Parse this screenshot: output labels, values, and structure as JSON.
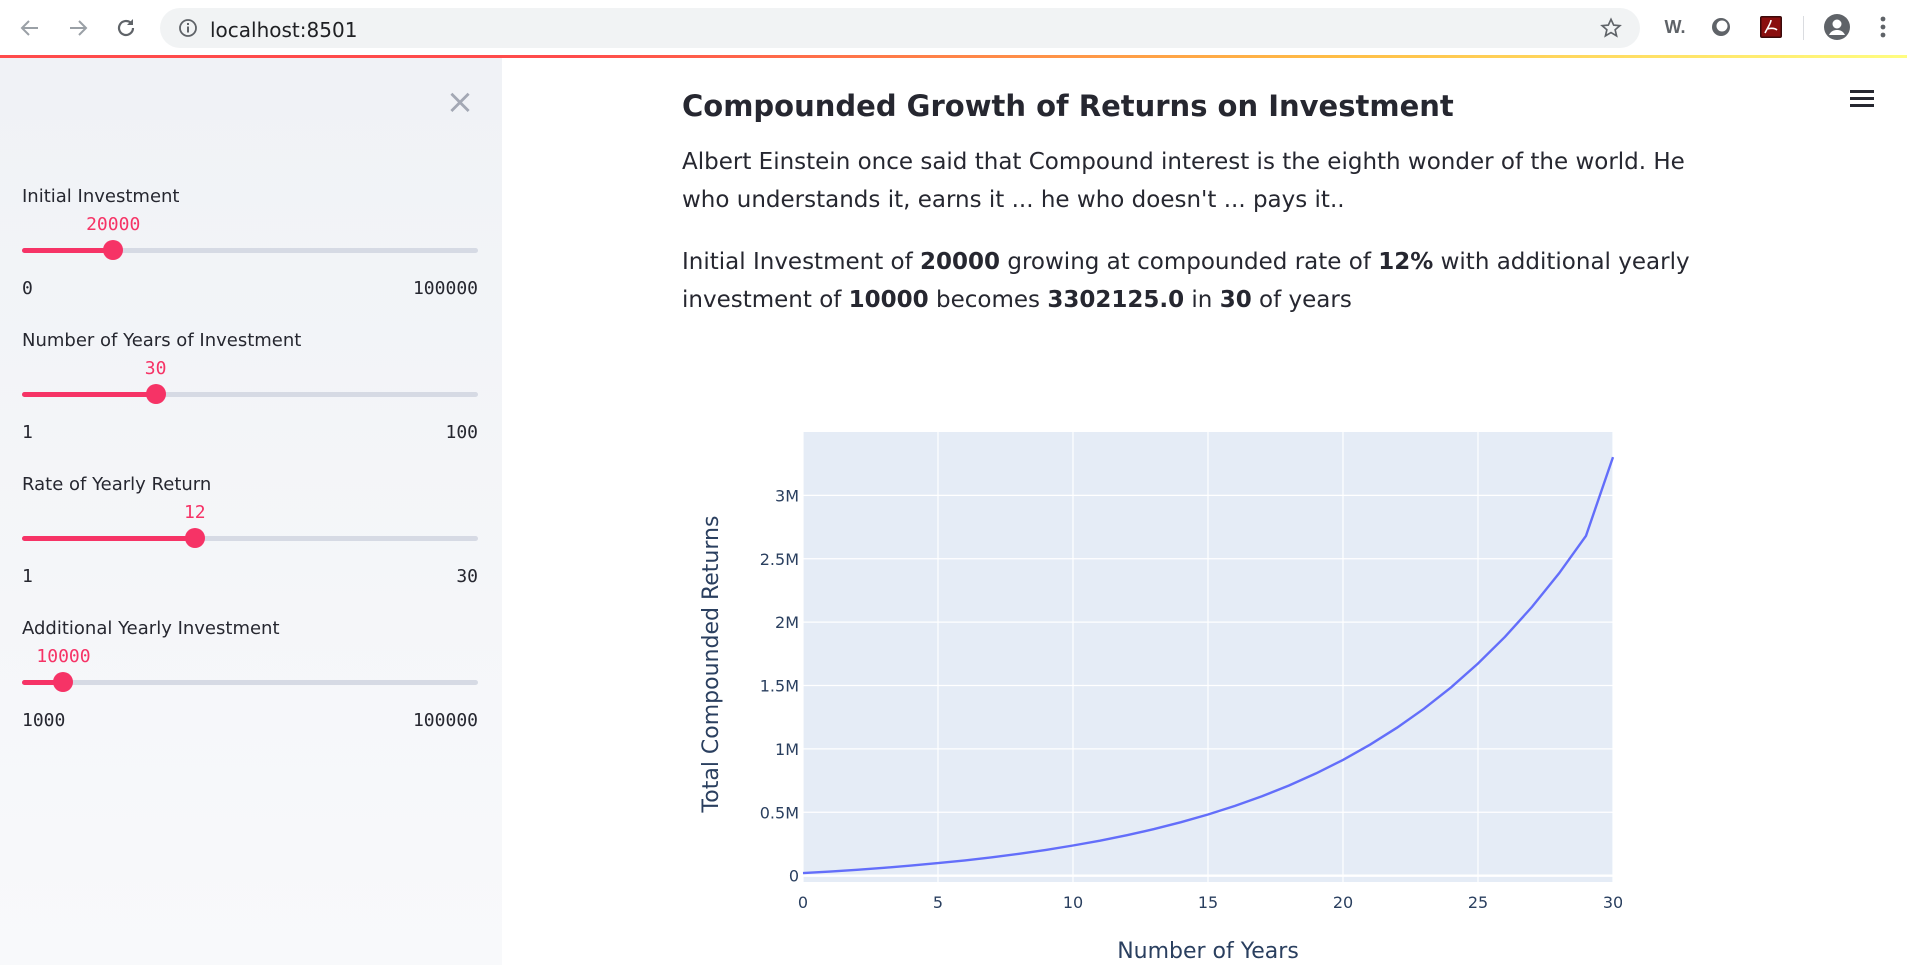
{
  "browser": {
    "url": "localhost:8501",
    "ext_w_label": "W."
  },
  "sidebar": {
    "close_label": "×",
    "sliders": [
      {
        "label": "Initial Investment",
        "value": "20000",
        "min": "0",
        "max": "100000",
        "fraction": 0.2
      },
      {
        "label": "Number of Years of Investment",
        "value": "30",
        "min": "1",
        "max": "100",
        "fraction": 0.293
      },
      {
        "label": "Rate of Yearly Return",
        "value": "12",
        "min": "1",
        "max": "30",
        "fraction": 0.379
      },
      {
        "label": "Additional Yearly Investment",
        "value": "10000",
        "min": "1000",
        "max": "100000",
        "fraction": 0.091
      }
    ]
  },
  "main": {
    "title": "Compounded Growth of Returns on Investment",
    "quote_text": "Albert Einstein once said that Compound interest is the eighth wonder of the world. He who understands it, earns it ... he who doesn't ... pays it..",
    "summary": {
      "part1": "Initial Investment of ",
      "initial": "20000",
      "part2": " growing at compounded rate of ",
      "rate": "12%",
      "part3": " with additional yearly investment of ",
      "additional": "10000",
      "part4": " becomes ",
      "result": "3302125.0",
      "part5": " in ",
      "years": "30",
      "part6": " of years"
    }
  },
  "colors": {
    "accent": "#f63366",
    "line": "#636efa",
    "plot_bg": "#e5ecf6"
  },
  "chart_data": {
    "type": "line",
    "title": "",
    "xlabel": "Number of Years",
    "ylabel": "Total Compounded Returns",
    "xlim": [
      0,
      30
    ],
    "ylim": [
      -50000,
      3500000
    ],
    "xticks": [
      0,
      5,
      10,
      15,
      20,
      25,
      30
    ],
    "xtick_labels": [
      "0",
      "5",
      "10",
      "15",
      "20",
      "25",
      "30"
    ],
    "yticks": [
      0,
      500000,
      1000000,
      1500000,
      2000000,
      2500000,
      3000000
    ],
    "ytick_labels": [
      "0",
      "0.5M",
      "1M",
      "1.5M",
      "2M",
      "2.5M",
      "3M"
    ],
    "grid": true,
    "series": [
      {
        "x": [
          0,
          1,
          2,
          3,
          4,
          5,
          6,
          7,
          8,
          9,
          10,
          11,
          12,
          13,
          14,
          15,
          16,
          17,
          18,
          19,
          20,
          21,
          22,
          23,
          24,
          25,
          26,
          27,
          28,
          29,
          30
        ],
        "values": [
          20000,
          32400,
          46288,
          61843,
          79264,
          98776,
          120629,
          145105,
          172518,
          203220,
          237606,
          276119,
          319252,
          367563,
          421670,
          482270,
          550143,
          626160,
          711299,
          806655,
          913454,
          1033069,
          1167037,
          1317082,
          1485131,
          1673347,
          1884149,
          2120247,
          2384677,
          2680838,
          3302125
        ]
      }
    ]
  }
}
